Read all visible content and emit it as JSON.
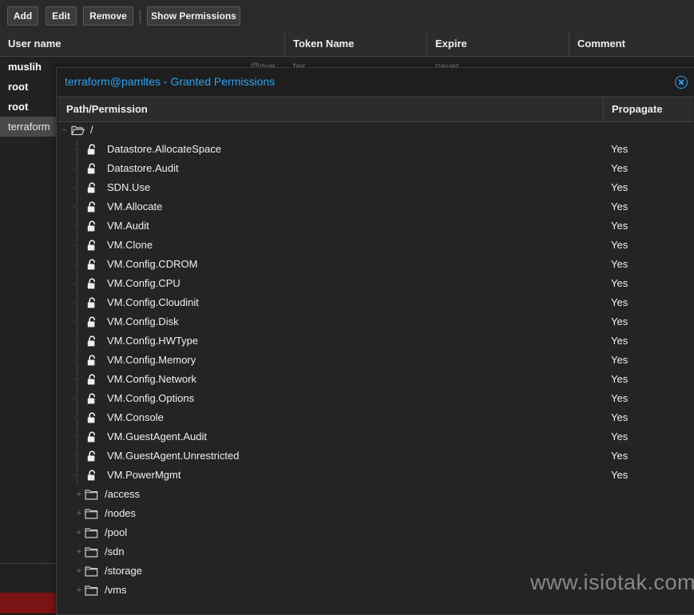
{
  "toolbar": {
    "add_label": "Add",
    "edit_label": "Edit",
    "remove_label": "Remove",
    "show_permissions_label": "Show Permissions"
  },
  "grid": {
    "columns": [
      "User name",
      "Token Name",
      "Expire",
      "Comment"
    ],
    "rows": [
      {
        "user": "muslih",
        "extra_user": "@pve",
        "token": "tes",
        "expire": "never"
      },
      {
        "user": "root"
      },
      {
        "user": "root"
      },
      {
        "user": "terraform"
      }
    ]
  },
  "dialog": {
    "title": "terraform@pamltes - Granted Permissions",
    "columns": {
      "path": "Path/Permission",
      "propagate": "Propagate"
    },
    "root_path": "/",
    "permissions": [
      {
        "name": "Datastore.AllocateSpace",
        "propagate": "Yes"
      },
      {
        "name": "Datastore.Audit",
        "propagate": "Yes"
      },
      {
        "name": "SDN.Use",
        "propagate": "Yes"
      },
      {
        "name": "VM.Allocate",
        "propagate": "Yes"
      },
      {
        "name": "VM.Audit",
        "propagate": "Yes"
      },
      {
        "name": "VM.Clone",
        "propagate": "Yes"
      },
      {
        "name": "VM.Config.CDROM",
        "propagate": "Yes"
      },
      {
        "name": "VM.Config.CPU",
        "propagate": "Yes"
      },
      {
        "name": "VM.Config.Cloudinit",
        "propagate": "Yes"
      },
      {
        "name": "VM.Config.Disk",
        "propagate": "Yes"
      },
      {
        "name": "VM.Config.HWType",
        "propagate": "Yes"
      },
      {
        "name": "VM.Config.Memory",
        "propagate": "Yes"
      },
      {
        "name": "VM.Config.Network",
        "propagate": "Yes"
      },
      {
        "name": "VM.Config.Options",
        "propagate": "Yes"
      },
      {
        "name": "VM.Console",
        "propagate": "Yes"
      },
      {
        "name": "VM.GuestAgent.Audit",
        "propagate": "Yes"
      },
      {
        "name": "VM.GuestAgent.Unrestricted",
        "propagate": "Yes"
      },
      {
        "name": "VM.PowerMgmt",
        "propagate": "Yes"
      }
    ],
    "folders": [
      "/access",
      "/nodes",
      "/pool",
      "/sdn",
      "/storage",
      "/vms"
    ]
  },
  "watermark": "www.isiotak.com",
  "icons": {
    "permission": "unlock-icon",
    "folder": "folder-icon",
    "folder_open": "folder-open-icon",
    "close": "close-icon",
    "expander": "plus-icon"
  },
  "colors": {
    "accent": "#29a3f2",
    "selected_row": "#4a4a4a",
    "bottom_bar": "#7a1414"
  }
}
